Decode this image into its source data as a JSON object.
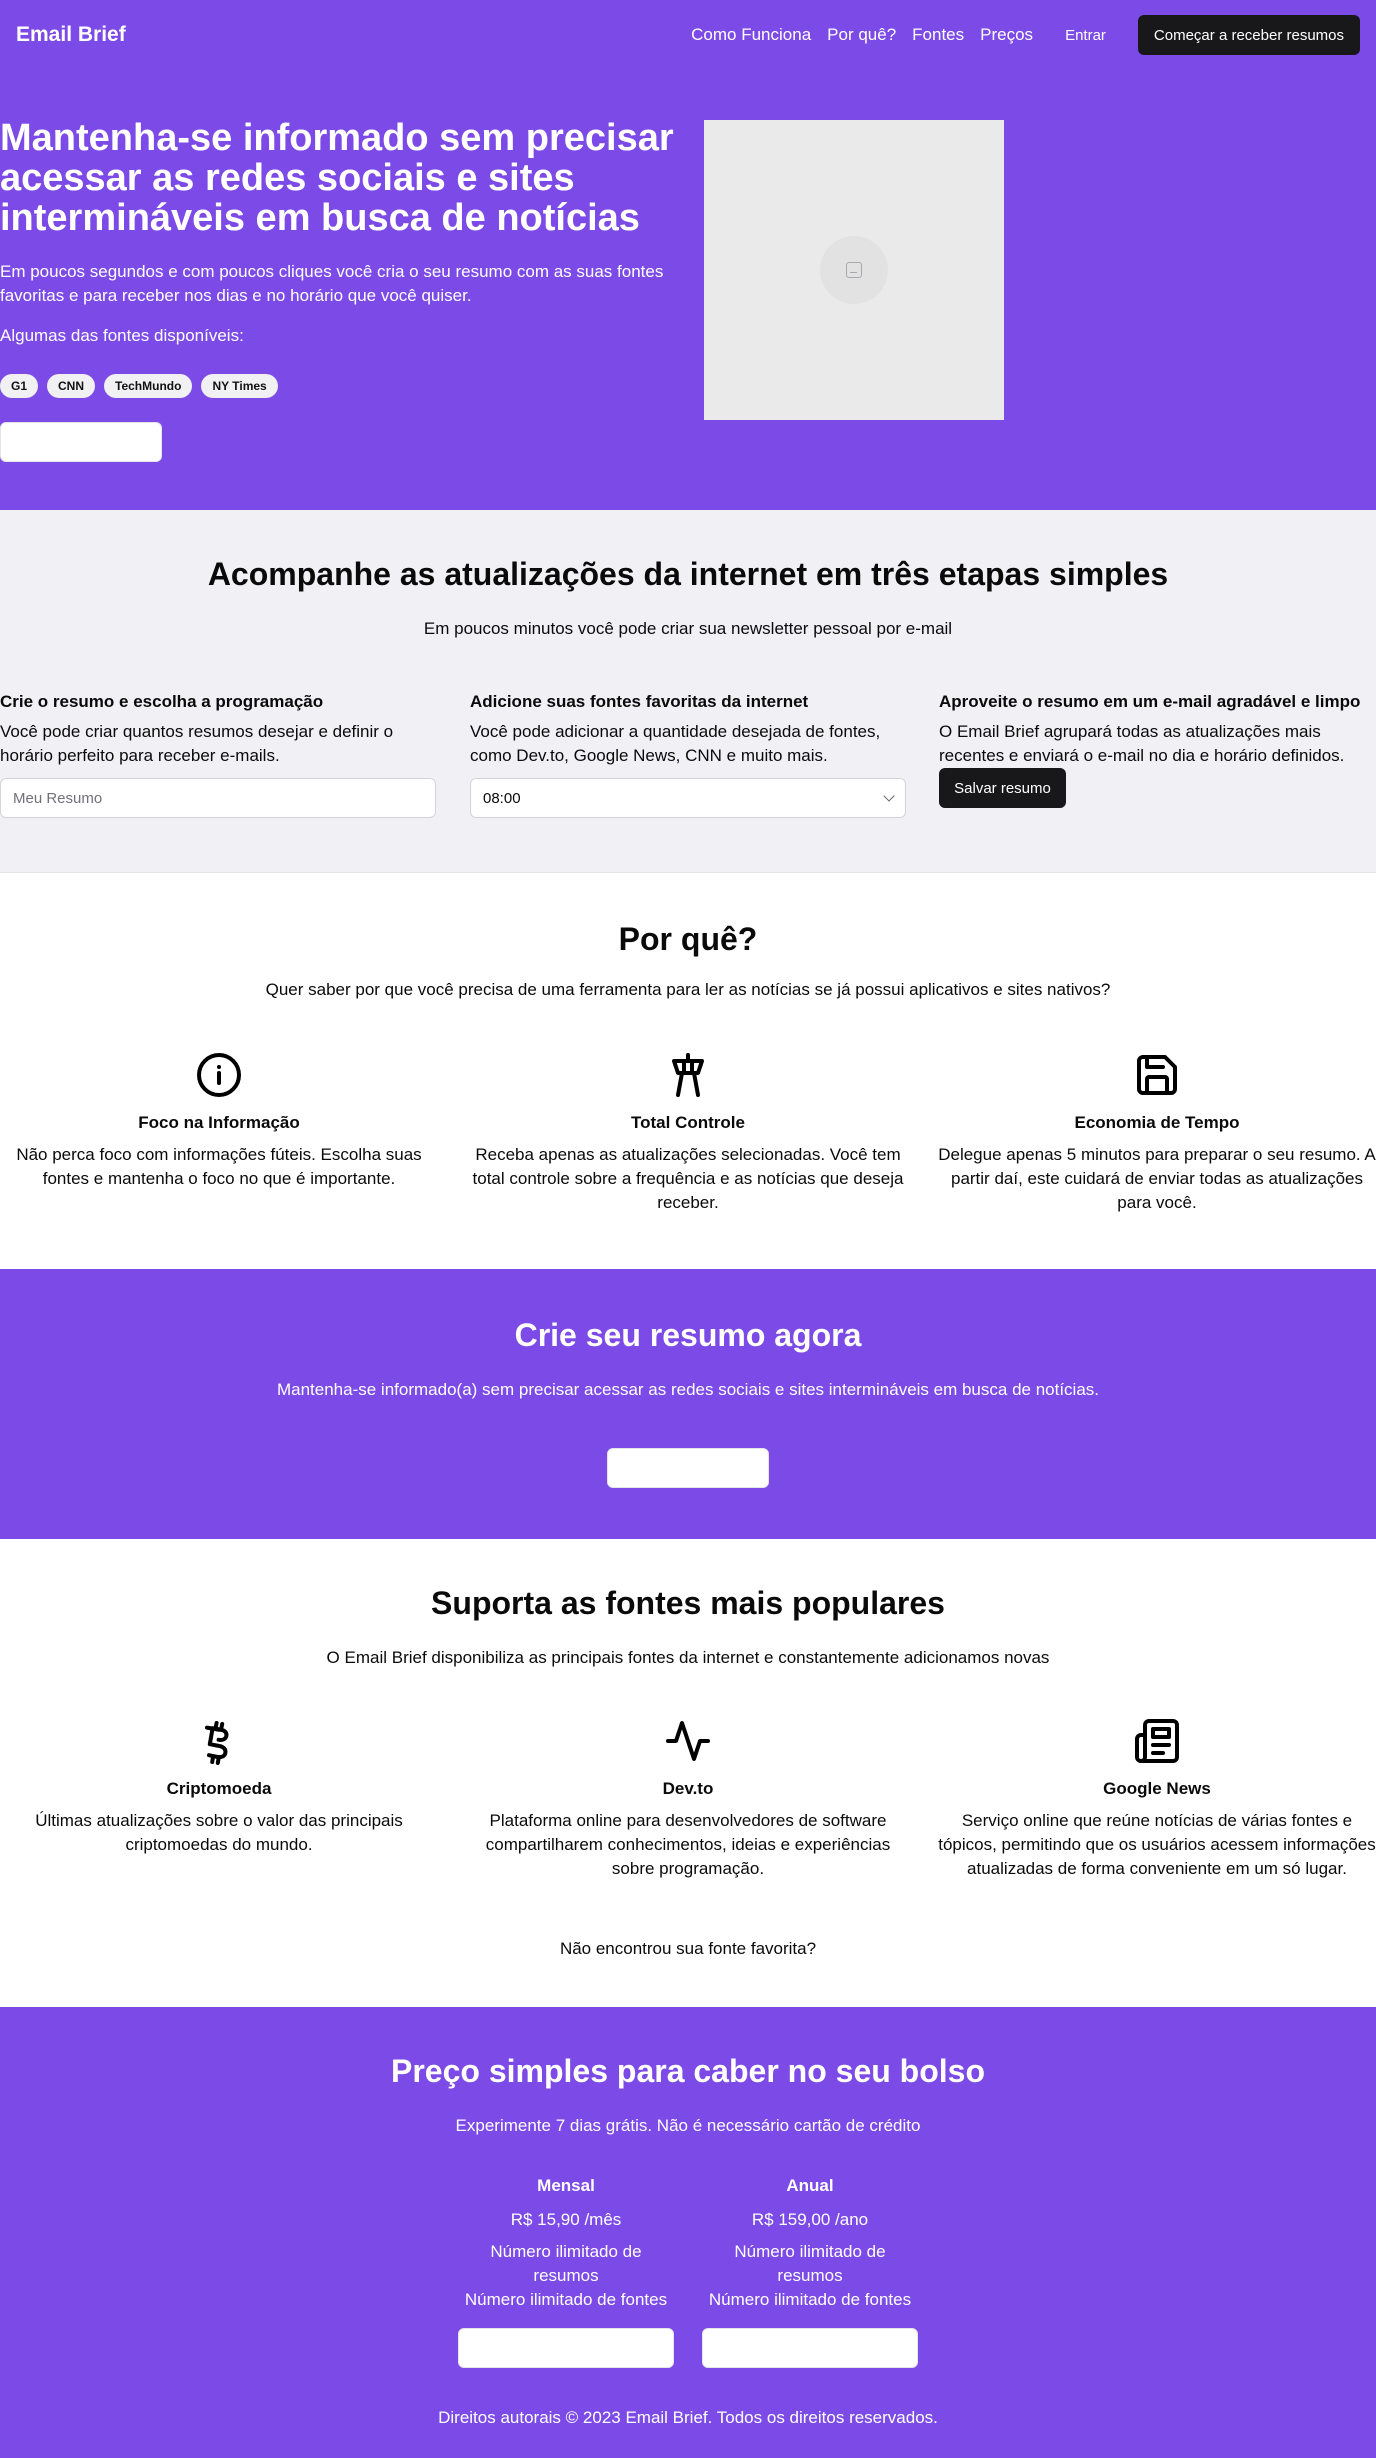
{
  "nav": {
    "brand": "Email Brief",
    "links": [
      "Como Funciona",
      "Por quê?",
      "Fontes",
      "Preços"
    ],
    "login": "Entrar",
    "cta": "Começar a receber resumos"
  },
  "hero": {
    "title": "Mantenha-se informado sem precisar acessar as redes sociais e sites intermináveis em busca de notícias",
    "description": "Em poucos segundos e com poucos cliques você cria o seu resumo com as suas fontes favoritas e para receber nos dias e no horário que você quiser.",
    "sources_label": "Algumas das fontes disponíveis:",
    "chips": [
      "G1",
      "CNN",
      "TechMundo",
      "NY Times"
    ],
    "image_icon": "image-placeholder-icon"
  },
  "steps": {
    "title": "Acompanhe as atualizações da internet em três etapas simples",
    "subtitle": "Em poucos minutos você pode criar sua newsletter pessoal por e-mail",
    "items": [
      {
        "title": "Crie o resumo e escolha a programação",
        "text": "Você pode criar quantos resumos desejar e definir o horário perfeito para receber e-mails.",
        "input_placeholder": "Meu Resumo"
      },
      {
        "title": "Adicione suas fontes favoritas da internet",
        "text": "Você pode adicionar a quantidade desejada de fontes, como Dev.to, Google News, CNN e muito mais.",
        "select_value": "08:00"
      },
      {
        "title": "Aproveite o resumo em um e-mail agradável e limpo",
        "text": "O Email Brief agrupará todas as atualizações mais recentes e enviará o e-mail no dia e horário definidos.",
        "button": "Salvar resumo"
      }
    ]
  },
  "why": {
    "title": "Por quê?",
    "subtitle": "Quer saber por que você precisa de uma ferramenta para ler as notícias se já possui aplicativos e sites nativos?",
    "items": [
      {
        "icon": "info-icon",
        "title": "Foco na Informação",
        "text": "Não perca foco com informações fúteis. Escolha suas fontes e mantenha o foco no que é importante."
      },
      {
        "icon": "control-tower-icon",
        "title": "Total Controle",
        "text": "Receba apenas as atualizações selecionadas. Você tem total controle sobre a frequência e as notícias que deseja receber."
      },
      {
        "icon": "floppy-disk-icon",
        "title": "Economia de Tempo",
        "text": "Delegue apenas 5 minutos para preparar o seu resumo. A partir daí, este cuidará de enviar todas as atualizações para você."
      }
    ]
  },
  "cta": {
    "title": "Crie seu resumo agora",
    "subtitle": "Mantenha-se informado(a) sem precisar acessar as redes sociais e sites intermináveis em busca de notícias."
  },
  "sources": {
    "title": "Suporta as fontes mais populares",
    "subtitle": "O Email Brief disponibiliza as principais fontes da internet e constantemente adicionamos novas",
    "items": [
      {
        "icon": "bitcoin-icon",
        "title": "Criptomoeda",
        "text": "Últimas atualizações sobre o valor das principais criptomoedas do mundo."
      },
      {
        "icon": "activity-icon",
        "title": "Dev.to",
        "text": "Plataforma online para desenvolvedores de software compartilharem conhecimentos, ideias e experiências sobre programação."
      },
      {
        "icon": "newspaper-icon",
        "title": "Google News",
        "text": "Serviço online que reúne notícias de várias fontes e tópicos, permitindo que os usuários acessem informações atualizadas de forma conveniente em um só lugar."
      }
    ],
    "not_found": "Não encontrou sua fonte favorita?"
  },
  "pricing": {
    "title": "Preço simples para caber no seu bolso",
    "subtitle": "Experimente 7 dias grátis. Não é necessário cartão de crédito",
    "plans": [
      {
        "name": "Mensal",
        "price": "R$ 15,90 /mês",
        "features": [
          "Número ilimitado de resumos",
          "Número ilimitado de fontes"
        ]
      },
      {
        "name": "Anual",
        "price": "R$ 159,00 /ano",
        "features": [
          "Número ilimitado de resumos",
          "Número ilimitado de fontes"
        ]
      }
    ]
  },
  "footer": {
    "text": "Direitos autorais © 2023 Email Brief. Todos os direitos reservados."
  },
  "colors": {
    "brand_purple": "#7c4ae6",
    "dark_button": "#18181b",
    "steps_background": "#f1f0f4"
  }
}
